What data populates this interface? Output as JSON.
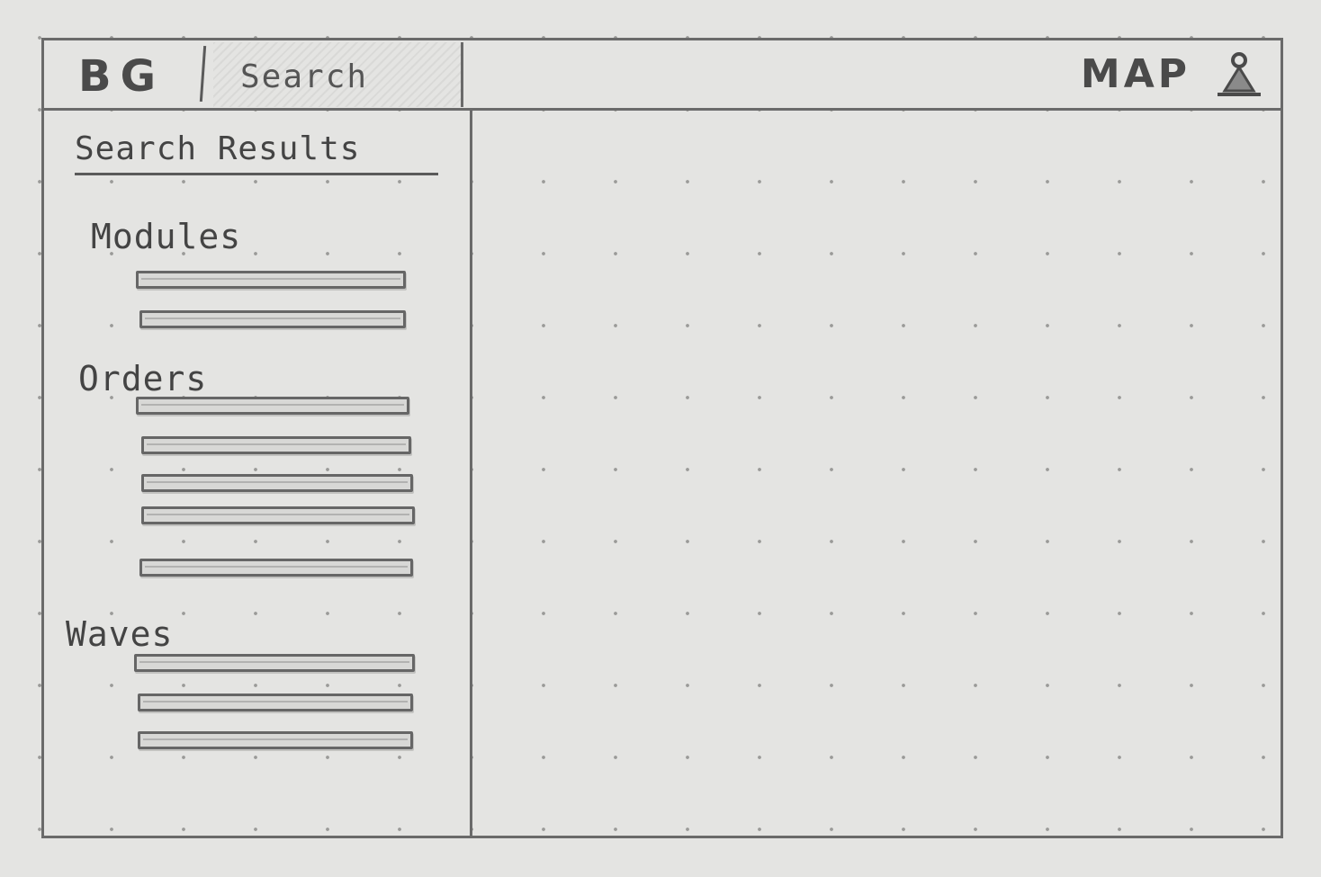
{
  "header": {
    "logo": "BG",
    "search_text": "Search",
    "map_title": "MAP"
  },
  "sidebar": {
    "heading": "Search Results",
    "sections": [
      {
        "title": "Modules",
        "item_count": 2
      },
      {
        "title": "Orders",
        "item_count": 5
      },
      {
        "title": "Waves",
        "item_count": 3
      }
    ]
  },
  "icons": {
    "user": "user-icon"
  },
  "colors": {
    "paper": "#e4e4e2",
    "pencil": "#6a6a6a"
  }
}
